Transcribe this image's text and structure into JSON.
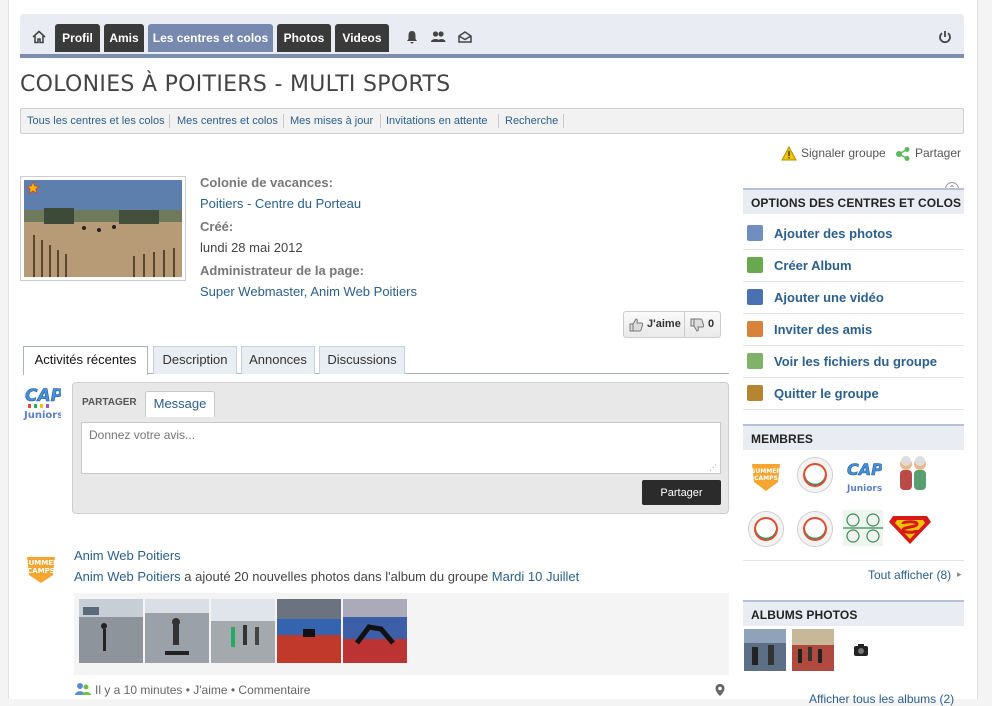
{
  "nav": {
    "home_icon": "home-icon",
    "items": [
      {
        "label": "Profil",
        "active": false
      },
      {
        "label": "Amis",
        "active": false
      },
      {
        "label": "Les centres et colos",
        "active": true
      },
      {
        "label": "Photos",
        "active": false
      },
      {
        "label": "Videos",
        "active": false
      }
    ],
    "icons": [
      "bell-icon",
      "users-icon",
      "mail-icon"
    ],
    "power_icon": "power-icon",
    "accent": "#7889b0"
  },
  "page_title": "COLONIES À POITIERS - MULTI SPORTS",
  "subnav": [
    "Tous les centres et les colos",
    "Mes centres et colos",
    "Mes mises à jour",
    "Invitations en attente",
    "Recherche"
  ],
  "actions": {
    "report": "Signaler groupe",
    "share": "Partager"
  },
  "group": {
    "category_label": "Colonie de vacances:",
    "category_value": "Poitiers - Centre du Porteau",
    "created_label": "Créé:",
    "created_value": "lundi 28 mai 2012",
    "admin_label": "Administrateur de la page:",
    "admin_value": "Super Webmaster, Anim Web Poitiers"
  },
  "like": {
    "label": "J'aime",
    "dislike_count": "0"
  },
  "tabs": [
    "Activités récentes",
    "Description",
    "Annonces",
    "Discussions"
  ],
  "share": {
    "label": "PARTAGER",
    "tab": "Message",
    "placeholder": "Donnez votre avis...",
    "button": "Partager"
  },
  "feed": {
    "author": "Anim Web Poitiers",
    "actor": "Anim Web Poitiers",
    "text": " a ajouté 20 nouvelles photos dans l'album du groupe ",
    "album": "Mardi 10 Juillet",
    "meta": "Il y a 10 minutes • J'aime • Commentaire"
  },
  "sidebar": {
    "options_title": "OPTIONS DES CENTRES ET COLOS",
    "options": [
      {
        "label": "Ajouter des photos",
        "icon": "photo-icon"
      },
      {
        "label": "Créer Album",
        "icon": "album-icon"
      },
      {
        "label": "Ajouter une vidéo",
        "icon": "video-icon"
      },
      {
        "label": "Inviter des amis",
        "icon": "invite-icon"
      },
      {
        "label": "Voir les fichiers du groupe",
        "icon": "file-icon"
      },
      {
        "label": "Quitter le groupe",
        "icon": "exit-icon"
      }
    ],
    "members_title": "MEMBRES",
    "show_all": "Tout afficher (8)",
    "albums_title": "ALBUMS PHOTOS",
    "albums_show_all": "Afficher tous les albums (2)"
  }
}
